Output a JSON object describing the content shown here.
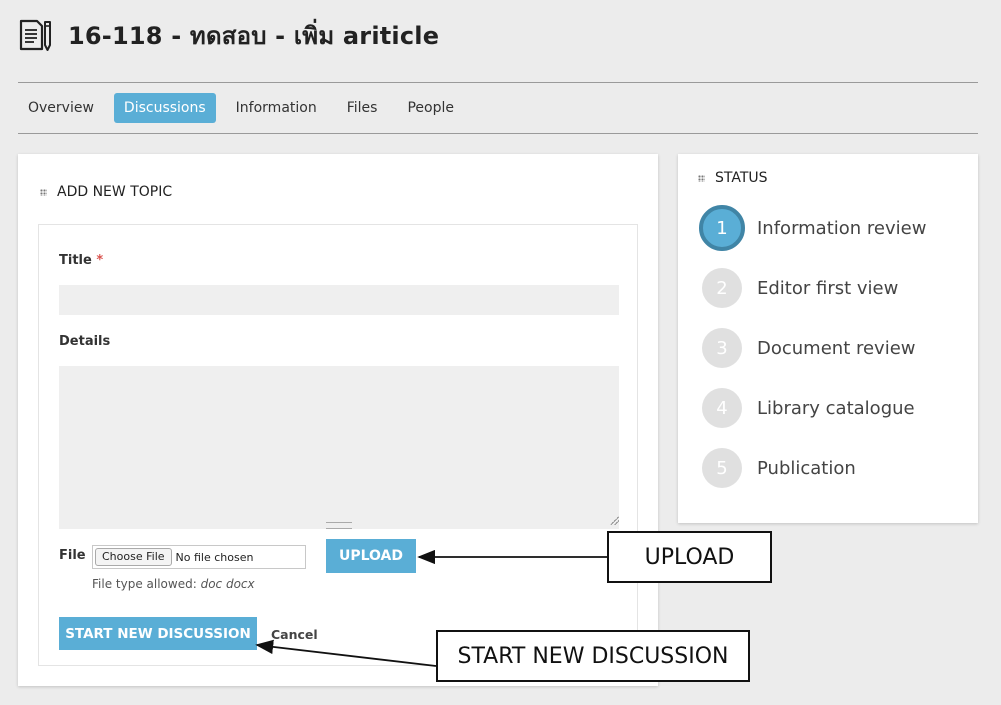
{
  "header": {
    "title": "16-118 - ทดสอบ - เพิ่ม ariticle",
    "icon": "document-edit-icon"
  },
  "tabs": [
    {
      "label": "Overview",
      "active": false
    },
    {
      "label": "Discussions",
      "active": true
    },
    {
      "label": "Information",
      "active": false
    },
    {
      "label": "Files",
      "active": false
    },
    {
      "label": "People",
      "active": false
    }
  ],
  "topic_form": {
    "heading": "ADD NEW TOPIC",
    "title_label": "Title",
    "required_mark": "*",
    "title_value": "",
    "details_label": "Details",
    "details_value": "",
    "file_label": "File",
    "choose_file_label": "Choose File",
    "no_file_text": "No file chosen",
    "upload_label": "UPLOAD",
    "file_hint_prefix": "File type allowed:",
    "file_hint_types": "doc docx",
    "start_label": "START NEW DISCUSSION",
    "cancel_label": "Cancel"
  },
  "status": {
    "heading": "STATUS",
    "steps": [
      {
        "number": "1",
        "label": "Information review",
        "active": true
      },
      {
        "number": "2",
        "label": "Editor first view",
        "active": false
      },
      {
        "number": "3",
        "label": "Document review",
        "active": false
      },
      {
        "number": "4",
        "label": "Library catalogue",
        "active": false
      },
      {
        "number": "5",
        "label": "Publication",
        "active": false
      }
    ]
  },
  "annotations": {
    "upload_callout": "UPLOAD",
    "start_callout": "START NEW DISCUSSION"
  },
  "colors": {
    "accent": "#5aaed6",
    "accent_dark": "#4085a6",
    "background": "#ececec",
    "required": "#d9534f"
  }
}
